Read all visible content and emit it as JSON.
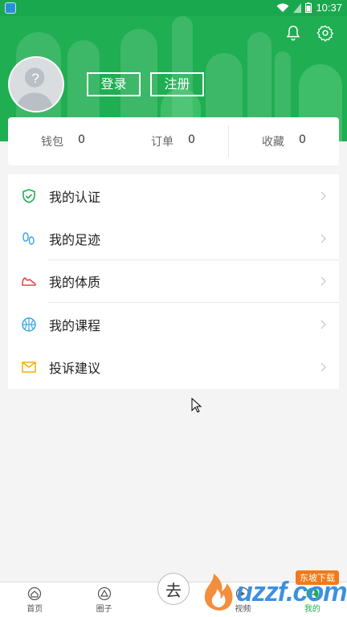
{
  "status_bar": {
    "time": "10:37"
  },
  "auth": {
    "login_label": "登录",
    "register_label": "注册"
  },
  "stats": [
    {
      "label": "钱包",
      "value": "0"
    },
    {
      "label": "订单",
      "value": "0"
    },
    {
      "label": "收藏",
      "value": "0"
    }
  ],
  "menu": [
    {
      "label": "我的认证",
      "icon": "shield-check-icon",
      "color": "#1fae52"
    },
    {
      "label": "我的足迹",
      "icon": "footprint-icon",
      "color": "#3aa8e0"
    },
    {
      "label": "我的体质",
      "icon": "sneaker-icon",
      "color": "#e04848"
    },
    {
      "label": "我的课程",
      "icon": "basketball-icon",
      "color": "#3aa8e0"
    },
    {
      "label": "投诉建议",
      "icon": "envelope-icon",
      "color": "#f0b21a"
    }
  ],
  "tabs": [
    {
      "label": "首页",
      "icon": "home-icon"
    },
    {
      "label": "圈子",
      "icon": "circle-icon"
    },
    {
      "label": "",
      "icon": "center-logo-icon"
    },
    {
      "label": "视频",
      "icon": "video-icon"
    },
    {
      "label": "我的",
      "icon": "profile-icon"
    }
  ],
  "center_glyph": "去",
  "watermark": {
    "text": "uzzf.com",
    "badge": "东坡下载"
  },
  "colors": {
    "brand": "#1fae52",
    "background": "#f4f4f4"
  }
}
